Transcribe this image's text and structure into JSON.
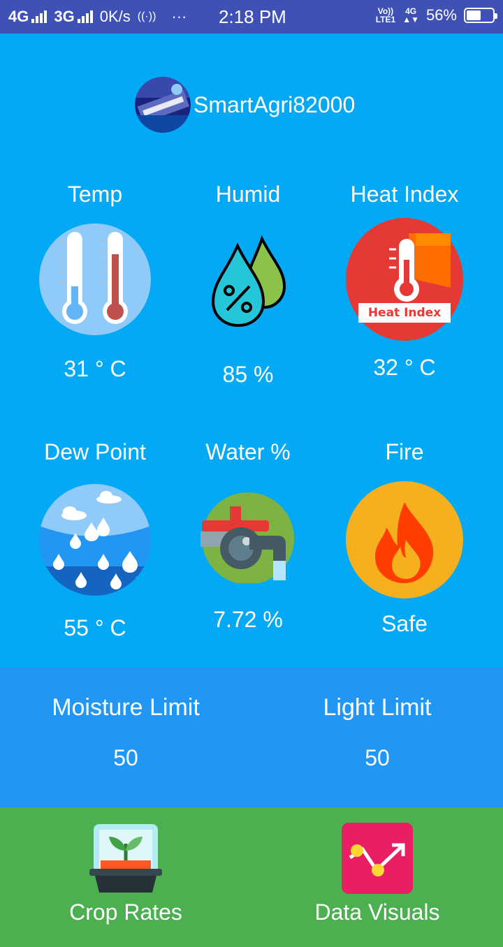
{
  "status_bar": {
    "network1": "4G",
    "network2": "3G",
    "speed": "0K/s",
    "time": "2:18 PM",
    "volte_line1": "Vo))",
    "volte_line2": "LTE1",
    "data_type": "4G",
    "battery": "56%",
    "battery_level": 0.56
  },
  "profile": {
    "username": "SmartAgri82000"
  },
  "sensors": [
    {
      "label": "Temp",
      "value": "31 ° C",
      "icon": "thermometer-icon"
    },
    {
      "label": "Humid",
      "value": "85 %",
      "icon": "humidity-drops-icon"
    },
    {
      "label": "Heat Index",
      "value": "32 ° C",
      "icon": "heat-index-icon",
      "badge": "Heat Index"
    },
    {
      "label": "Dew Point",
      "value": "55 ° C",
      "icon": "dew-point-icon"
    },
    {
      "label": "Water %",
      "value": "7.72 %",
      "icon": "water-tap-icon"
    },
    {
      "label": "Fire",
      "value": "Safe",
      "icon": "fire-icon"
    }
  ],
  "limits": {
    "moisture": {
      "label": "Moisture Limit",
      "value": "50"
    },
    "light": {
      "label": "Light Limit",
      "value": "50"
    }
  },
  "bottom_nav": {
    "crop_rates": "Crop Rates",
    "data_visuals": "Data Visuals"
  },
  "colors": {
    "status_bar": "#3f51b5",
    "main_bg": "#03a9f4",
    "limits_bg": "#2196f3",
    "nav_bg": "#4caf50"
  }
}
